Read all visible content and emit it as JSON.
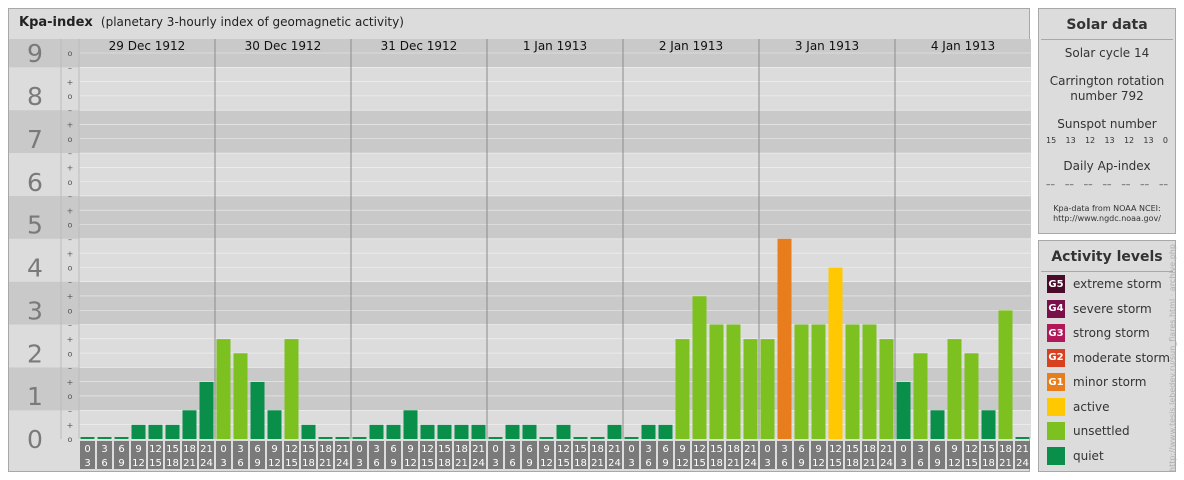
{
  "main": {
    "title": "Kpa-index",
    "subtitle": "(planetary 3-hourly index of geomagnetic activity)"
  },
  "chart_data": {
    "type": "bar",
    "y_levels": [
      "0",
      "1",
      "2",
      "3",
      "4",
      "5",
      "6",
      "7",
      "8",
      "9"
    ],
    "sublevel_marks": [
      "o",
      "+",
      "–"
    ],
    "ylim": [
      0,
      9.33
    ],
    "days": [
      {
        "label": "29 Dec 1912",
        "values": [
          0.0,
          0.0,
          0.0,
          0.33,
          0.33,
          0.33,
          0.67,
          1.33
        ]
      },
      {
        "label": "30 Dec 1912",
        "values": [
          2.33,
          2.0,
          1.33,
          0.67,
          2.33,
          0.33,
          0.0,
          0.0
        ]
      },
      {
        "label": "31 Dec 1912",
        "values": [
          0.0,
          0.33,
          0.33,
          0.67,
          0.33,
          0.33,
          0.33,
          0.33
        ]
      },
      {
        "label": "1 Jan 1913",
        "values": [
          0.0,
          0.33,
          0.33,
          0.0,
          0.33,
          0.0,
          0.0,
          0.33
        ]
      },
      {
        "label": "2 Jan 1913",
        "values": [
          0.0,
          0.33,
          0.33,
          2.33,
          3.33,
          2.67,
          2.67,
          2.33
        ]
      },
      {
        "label": "3 Jan 1913",
        "values": [
          2.33,
          4.67,
          2.67,
          2.67,
          4.0,
          2.67,
          2.67,
          2.33
        ]
      },
      {
        "label": "4 Jan 1913",
        "values": [
          1.33,
          2.0,
          0.67,
          2.33,
          2.0,
          0.67,
          3.0,
          0.0
        ]
      }
    ],
    "time_ticks": [
      {
        "top": "0",
        "bottom": "3"
      },
      {
        "top": "3",
        "bottom": "6"
      },
      {
        "top": "6",
        "bottom": "9"
      },
      {
        "top": "9",
        "bottom": "12"
      },
      {
        "top": "12",
        "bottom": "15"
      },
      {
        "top": "15",
        "bottom": "18"
      },
      {
        "top": "18",
        "bottom": "21"
      },
      {
        "top": "21",
        "bottom": "24"
      }
    ],
    "colors": {
      "quiet": "#0a8f4a",
      "unsettled": "#7cc11f",
      "active": "#ffc800",
      "g1": "#e87d1e",
      "g2": "#d9401f",
      "g3": "#b0185a",
      "g4": "#7a0f4a",
      "g5": "#4a0a2a",
      "band_dark": "#c9c9c9",
      "band_light": "#dcdcdc",
      "axis_label": "#7a7a7a",
      "tick_box": "#7a7a7a"
    }
  },
  "solar": {
    "title": "Solar data",
    "cycle": "Solar cycle 14",
    "carrington_line1": "Carrington rotation",
    "carrington_line2": "number 792",
    "sunspot_title": "Sunspot number",
    "sunspot_values": [
      "15",
      "13",
      "12",
      "13",
      "12",
      "13",
      "0"
    ],
    "ap_title": "Daily Ap-index",
    "ap_values": [
      "––",
      "––",
      "––",
      "––",
      "––",
      "––",
      "––"
    ],
    "credit_line1": "Kpa-data from NOAA NCEI:",
    "credit_line2": "http://www.ngdc.noaa.gov/"
  },
  "activity": {
    "title": "Activity levels",
    "items": [
      {
        "code": "G5",
        "label": "extreme storm",
        "color": "#4a0a2a"
      },
      {
        "code": "G4",
        "label": "severe storm",
        "color": "#7a0f4a"
      },
      {
        "code": "G3",
        "label": "strong storm",
        "color": "#b0185a"
      },
      {
        "code": "G2",
        "label": "moderate storm",
        "color": "#d9401f"
      },
      {
        "code": "G1",
        "label": "minor storm",
        "color": "#e87d1e"
      },
      {
        "code": "",
        "label": "active",
        "color": "#ffc800"
      },
      {
        "code": "",
        "label": "unsettled",
        "color": "#7cc11f"
      },
      {
        "code": "",
        "label": "quiet",
        "color": "#0a8f4a"
      }
    ]
  },
  "watermark": "http://www.tesis.lebedev.ru/sun_flares.html · archive.php"
}
